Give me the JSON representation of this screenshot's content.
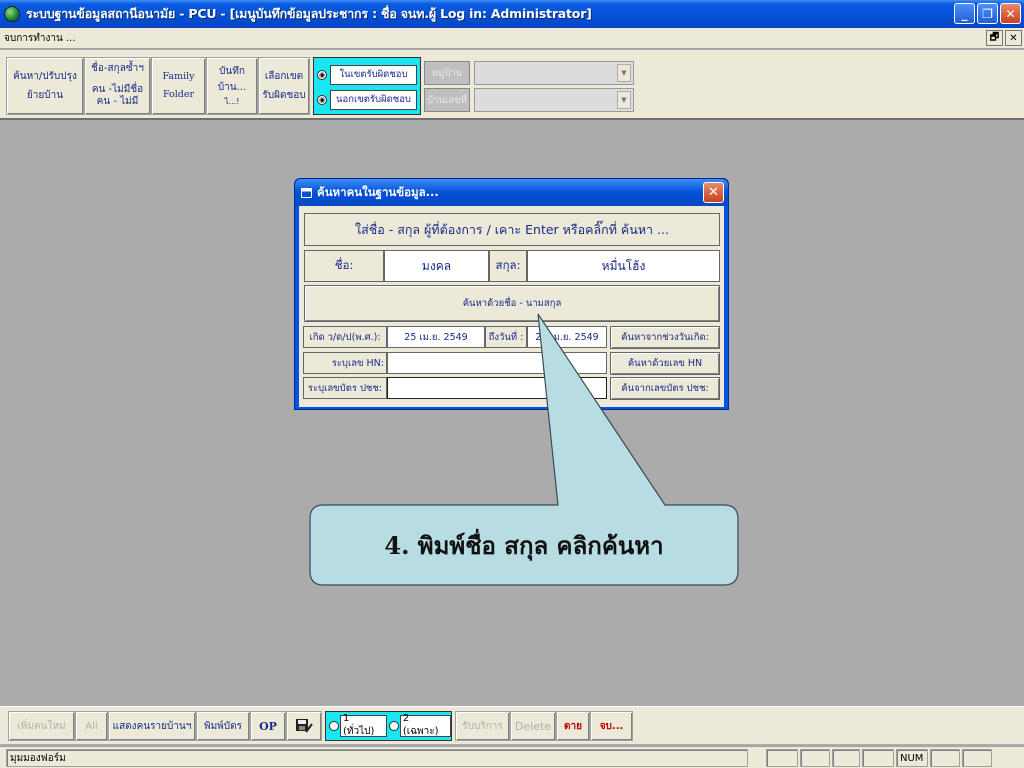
{
  "window": {
    "title": "ระบบฐานข้อมูลสถานีอนามัย - PCU - [เมนูบันทึกข้อมูลประชากร : ชื่อ จนท.ผู้ Log in: Administrator]",
    "minimize": "_",
    "restore": "❐",
    "close": "✕"
  },
  "menuline": {
    "label": "จบการทำงาน ..."
  },
  "mdi": {
    "restore": "🗗",
    "close": "✕"
  },
  "toolbar": {
    "buttons": [
      {
        "line1": "ค้นหา/ปรับปรุง",
        "line2": "ย้ายบ้าน"
      },
      {
        "line1": "ชื่อ-สกุลซ้ำฯ",
        "line2": "คน -ไม่มีชื่อ",
        "line3": "คน - ไม่มี"
      },
      {
        "line1": "Family",
        "line2": "Folder"
      },
      {
        "line1": "บันทึก",
        "line2": "บ้าน...",
        "line3": "ไ...!"
      },
      {
        "line1": "เลือกเขต",
        "line2": "รับผิดชอบ"
      }
    ],
    "zone_options": [
      "ในเขตรับผิดชอบ",
      "นอกเขตรับผิดชอบ"
    ],
    "village_label": "หมู่บ้าน",
    "house_label": "บ้านเลขที่"
  },
  "dialog": {
    "title": "ค้นหาคนในฐานข้อมูล...",
    "close": "✕",
    "instruction": "ใส่ชื่อ - สกุล ผู้ที่ต้องการ / เคาะ Enter หรือคลิ๊กที่ ค้นหา ...",
    "first_name_label": "ชื่อ:",
    "first_name_value": "มงคล",
    "last_name_label": "สกุล:",
    "last_name_value": "หมื่นโฮ้ง",
    "search_name_button": "ค้นหาด้วยชื่อ - นามสกุล",
    "birth_label": "เกิด ว/ด/ป(พ.ศ.):",
    "birth_from": "25 เม.ย. 2549",
    "to_label": "ถึงวันที่ :",
    "birth_to": "25 เม.ย. 2549",
    "search_birth_button": "ค้นหาจากช่วงวันเกิด:",
    "hn_label": "ระบุเลข HN:",
    "hn_value": "",
    "search_hn_button": "ค้นหาด้วยเลข HN",
    "id_label": "ระบุเลขบัตร ปชช:",
    "id_value": "",
    "search_id_button": "ค้นจากเลขบัตร ปชช:"
  },
  "callout": {
    "text": "4. พิมพ์ชื่อ สกุล คลิกค้นหา"
  },
  "bottombar": {
    "add_person": "เพิ่มคนใหม่",
    "all": "All",
    "show_household": "แสดงคนรายบ้านฯ",
    "print_card": "พิมพ์บัตร",
    "op": "OP",
    "type_options": [
      "1 (ทั่วไป)",
      "2 (เฉพาะ)"
    ],
    "service": "รับบริการ",
    "delete": "Delete",
    "dead": "ตาย",
    "end": "จบ..."
  },
  "statusbar": {
    "text": "มุมมองฟอร์ม",
    "num": "NUM"
  }
}
